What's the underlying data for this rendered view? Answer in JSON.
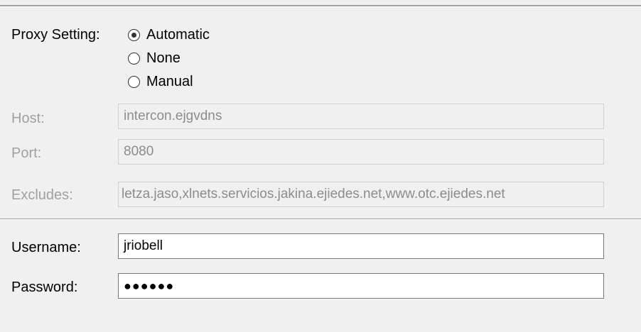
{
  "proxy": {
    "label": "Proxy Setting:",
    "options": [
      {
        "label": "Automatic",
        "checked": true
      },
      {
        "label": "None",
        "checked": false
      },
      {
        "label": "Manual",
        "checked": false
      }
    ]
  },
  "host": {
    "label": "Host:",
    "value": "intercon.ejgvdns"
  },
  "port": {
    "label": "Port:",
    "value": "8080"
  },
  "excludes": {
    "label": "Excludes:",
    "value": "letza.jaso,xlnets.servicios.jakina.ejiedes.net,www.otc.ejiedes.net"
  },
  "username": {
    "label": "Username:",
    "value": "jriobell"
  },
  "password": {
    "label": "Password:",
    "value": "●●●●●●"
  }
}
